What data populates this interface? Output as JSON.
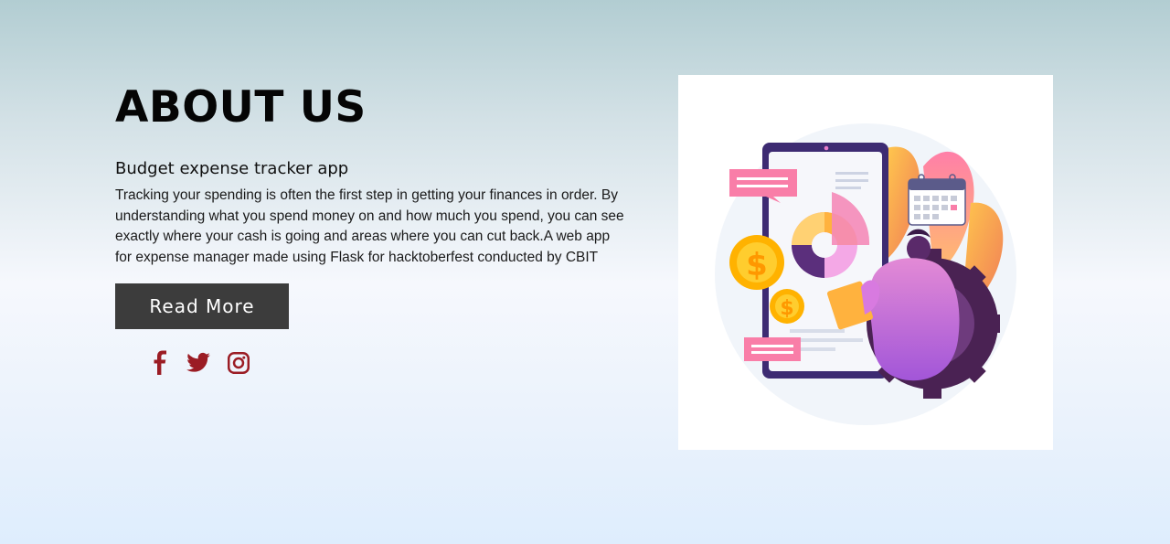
{
  "about": {
    "title": "ABOUT US",
    "subtitle": "Budget expense tracker app",
    "description": "Tracking your spending is often the first step in getting your finances in order. By understanding what you spend money on and how much you spend, you can see exactly where your cash is going and areas where you can cut back.A web app for expense manager made using Flask for hacktoberfest conducted by CBIT",
    "read_more_label": "Read More"
  },
  "social": [
    {
      "icon": "facebook-icon"
    },
    {
      "icon": "twitter-icon"
    },
    {
      "icon": "instagram-icon"
    }
  ],
  "colors": {
    "social_icon": "#9b1c24",
    "button_bg": "#3c3c3c",
    "button_text": "#ffffff",
    "heading": "#050505"
  },
  "illustration": {
    "icon": "finance-dashboard-illustration",
    "coin_symbol": "$"
  }
}
